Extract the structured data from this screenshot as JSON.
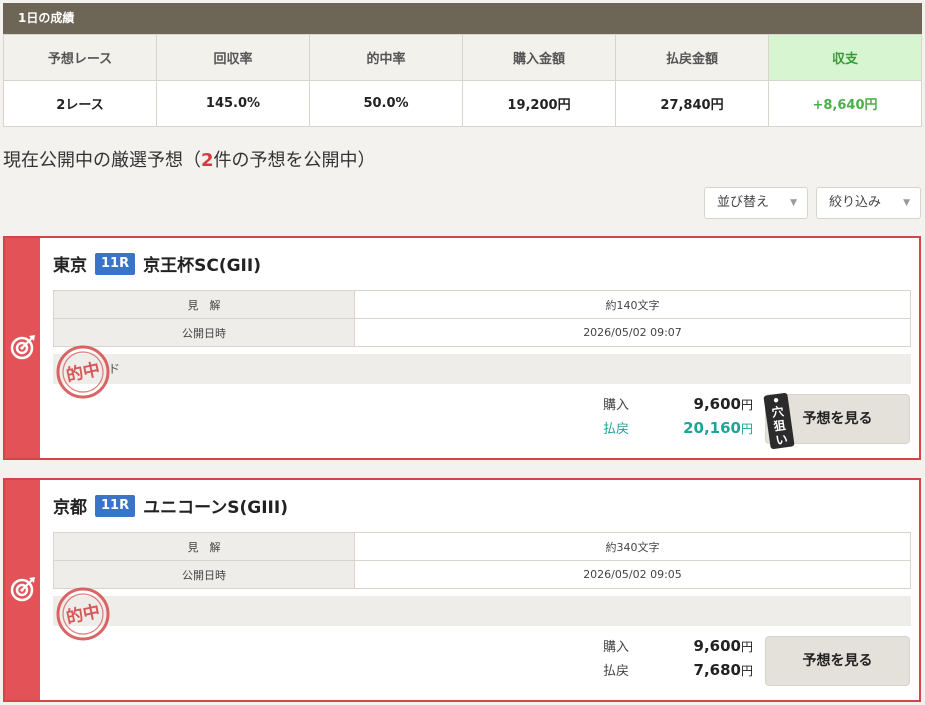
{
  "summary": {
    "header": "1日の成績",
    "columns": [
      "予想レース",
      "回収率",
      "的中率",
      "購入金額",
      "払戻金額",
      "収支"
    ],
    "values": [
      "2レース",
      "145.0%",
      "50.0%",
      "19,200円",
      "27,840円",
      "+8,640円"
    ]
  },
  "section": {
    "title_prefix": "現在公開中の厳選予想（",
    "count": "2",
    "title_suffix": "件の予想を公開中）"
  },
  "controls": {
    "sort_label": "並び替え",
    "filter_label": "絞り込み"
  },
  "cards": [
    {
      "venue": "東京",
      "race": "11R",
      "race_name": "京王杯SC(GII)",
      "label_view": "見　解",
      "value_view": "約140文字",
      "label_date": "公開日時",
      "value_date": "2026/05/02 09:07",
      "excerpt": "ド",
      "stamp_text": "的中",
      "purchase_label": "購入",
      "purchase_value": "9,600",
      "payout_label": "払戻",
      "payout_value": "20,160",
      "unit": "円",
      "tag": "穴狙い",
      "button": "予想を見る"
    },
    {
      "venue": "京都",
      "race": "11R",
      "race_name": "ユニコーンS(GIII)",
      "label_view": "見　解",
      "value_view": "約340文字",
      "label_date": "公開日時",
      "value_date": "2026/05/02 09:05",
      "excerpt": "",
      "stamp_text": "的中",
      "purchase_label": "購入",
      "purchase_value": "9,600",
      "payout_label": "払戻",
      "payout_value": "7,680",
      "unit": "円",
      "button": "予想を見る"
    }
  ],
  "colors": {
    "header_bg": "#6d6556",
    "card_accent": "#e35257",
    "race_badge": "#3a74c8",
    "profit_green": "#4ab04a",
    "payout_teal": "#21a395",
    "count_red": "#d9363e"
  }
}
